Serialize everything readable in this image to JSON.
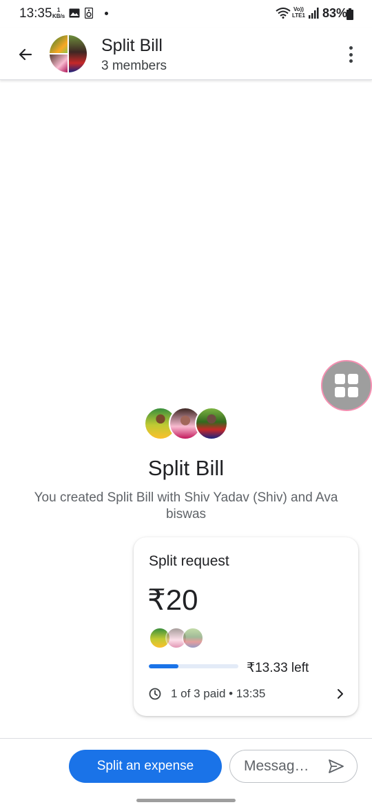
{
  "status_bar": {
    "time": "13:35",
    "net_speed_value": "1",
    "net_speed_unit": "KB/s",
    "volte_top": "Vo))",
    "volte_bottom": "LTE1",
    "battery": "83%",
    "icons": [
      "gallery-icon",
      "speaker-icon",
      "wifi-icon",
      "signal-icon",
      "battery-icon"
    ]
  },
  "app_bar": {
    "title": "Split Bill",
    "subtitle": "3 members",
    "icons": [
      "back-arrow-icon",
      "more-vert-icon"
    ]
  },
  "group_intro": {
    "name": "Split Bill",
    "description": "You created Split Bill with Shiv Yadav (Shiv) and Ava biswas"
  },
  "split_card": {
    "title": "Split request",
    "amount": "₹20",
    "remaining": "₹13.33 left",
    "paid_progress": 0.333,
    "paid_status": "1 of 3 paid • 13:35",
    "icons": [
      "clock-icon",
      "chevron-right-icon"
    ]
  },
  "bottom_bar": {
    "split_button_label": "Split an expense",
    "message_placeholder": "Messag…",
    "icons": [
      "send-icon"
    ]
  },
  "colors": {
    "primary": "#1a73e8",
    "progress_track": "#e3ebf7",
    "float_bubble": "#9e9e9e",
    "float_bubble_border": "#f48fb1"
  }
}
